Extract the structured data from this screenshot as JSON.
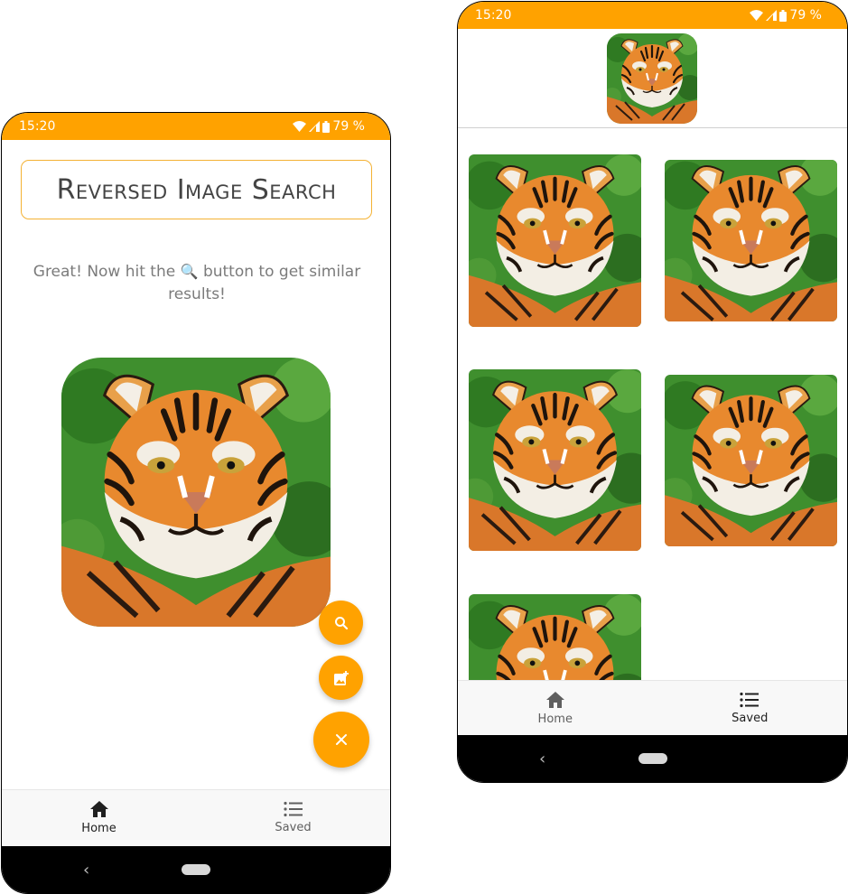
{
  "status_bar": {
    "time": "15:20",
    "battery": "79 %",
    "color": "#ffa200"
  },
  "search_screen": {
    "title": "Reversed Image Search",
    "hint_before": "Great! Now hit the ",
    "hint_icon": "🔍",
    "hint_after": " button to get similar results!",
    "selected_image_icon": "tiger-photo",
    "fab_buttons": [
      {
        "name": "search",
        "icon": "search-icon"
      },
      {
        "name": "add-image",
        "icon": "add-photo-icon"
      },
      {
        "name": "close",
        "icon": "close-icon"
      }
    ]
  },
  "results_screen": {
    "query_image_icon": "tiger-photo",
    "result_count": 5
  },
  "bottom_nav": {
    "home_label": "Home",
    "saved_label": "Saved"
  },
  "colors": {
    "accent": "#ffa200",
    "title_border": "#f4b234",
    "hint_text": "#7b7b7b"
  }
}
